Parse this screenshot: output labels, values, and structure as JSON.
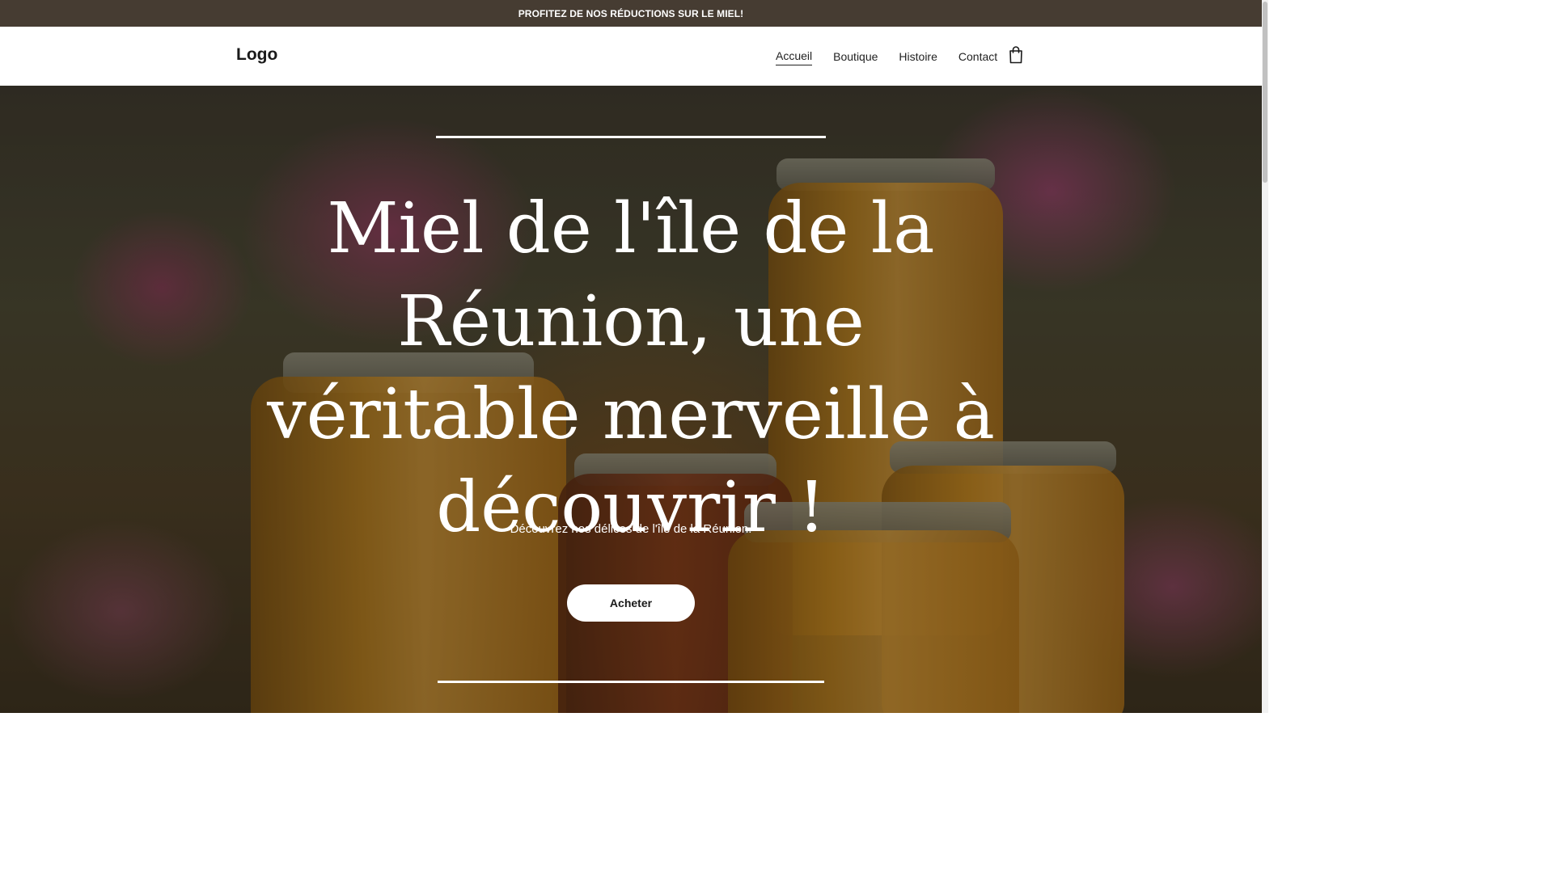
{
  "announcement": {
    "text": "PROFITEZ DE NOS RÉDUCTIONS SUR LE MIEL!"
  },
  "header": {
    "logo": "Logo",
    "nav": [
      {
        "label": "Accueil",
        "active": true
      },
      {
        "label": "Boutique",
        "active": false
      },
      {
        "label": "Histoire",
        "active": false
      },
      {
        "label": "Contact",
        "active": false
      }
    ],
    "cart_icon": "shopping-bag-icon"
  },
  "hero": {
    "title": "Miel de l'île de la Réunion, une véritable merveille à découvrir !",
    "subtitle": "Découvrez nos délices de l'île de la Réunion.",
    "cta_label": "Acheter"
  },
  "colors": {
    "announcement_bg": "#463c32",
    "header_bg": "#ffffff",
    "text_dark": "#1a1a1a",
    "hero_text": "#ffffff"
  }
}
